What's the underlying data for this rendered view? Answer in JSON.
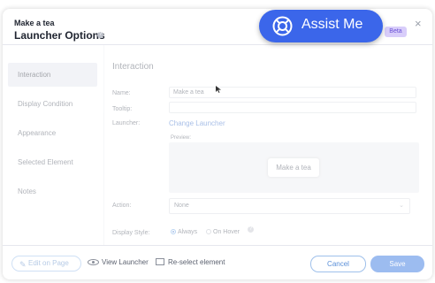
{
  "header": {
    "subtitle": "Make a tea",
    "title": "Launcher Options",
    "help_icon": "help-circle-icon",
    "beta_badge": "Beta",
    "close": "×"
  },
  "assist": {
    "label": "Assist Me",
    "icon": "life-ring-icon",
    "color": "#3b66ea"
  },
  "sidebar": {
    "items": [
      {
        "label": "Interaction",
        "active": true
      },
      {
        "label": "Display Condition"
      },
      {
        "label": "Appearance"
      },
      {
        "label": "Selected Element"
      },
      {
        "label": "Notes"
      }
    ]
  },
  "main": {
    "section_title": "Interaction",
    "name_label": "Name:",
    "name_value": "Make a tea",
    "tooltip_label": "Tooltip:",
    "tooltip_value": "",
    "launcher_label": "Launcher:",
    "change_launcher": "Change Launcher",
    "preview_label": "Preview:",
    "preview_text": "Make a tea",
    "action_label": "Action:",
    "action_value": "None",
    "display_style_label": "Display Style:",
    "display_options": [
      "Always",
      "On Hover"
    ],
    "display_selected": "Always"
  },
  "footer": {
    "edit_on_page": "Edit on Page",
    "view_launcher": "View Launcher",
    "reselect": "Re-select element",
    "cancel": "Cancel",
    "save": "Save"
  }
}
